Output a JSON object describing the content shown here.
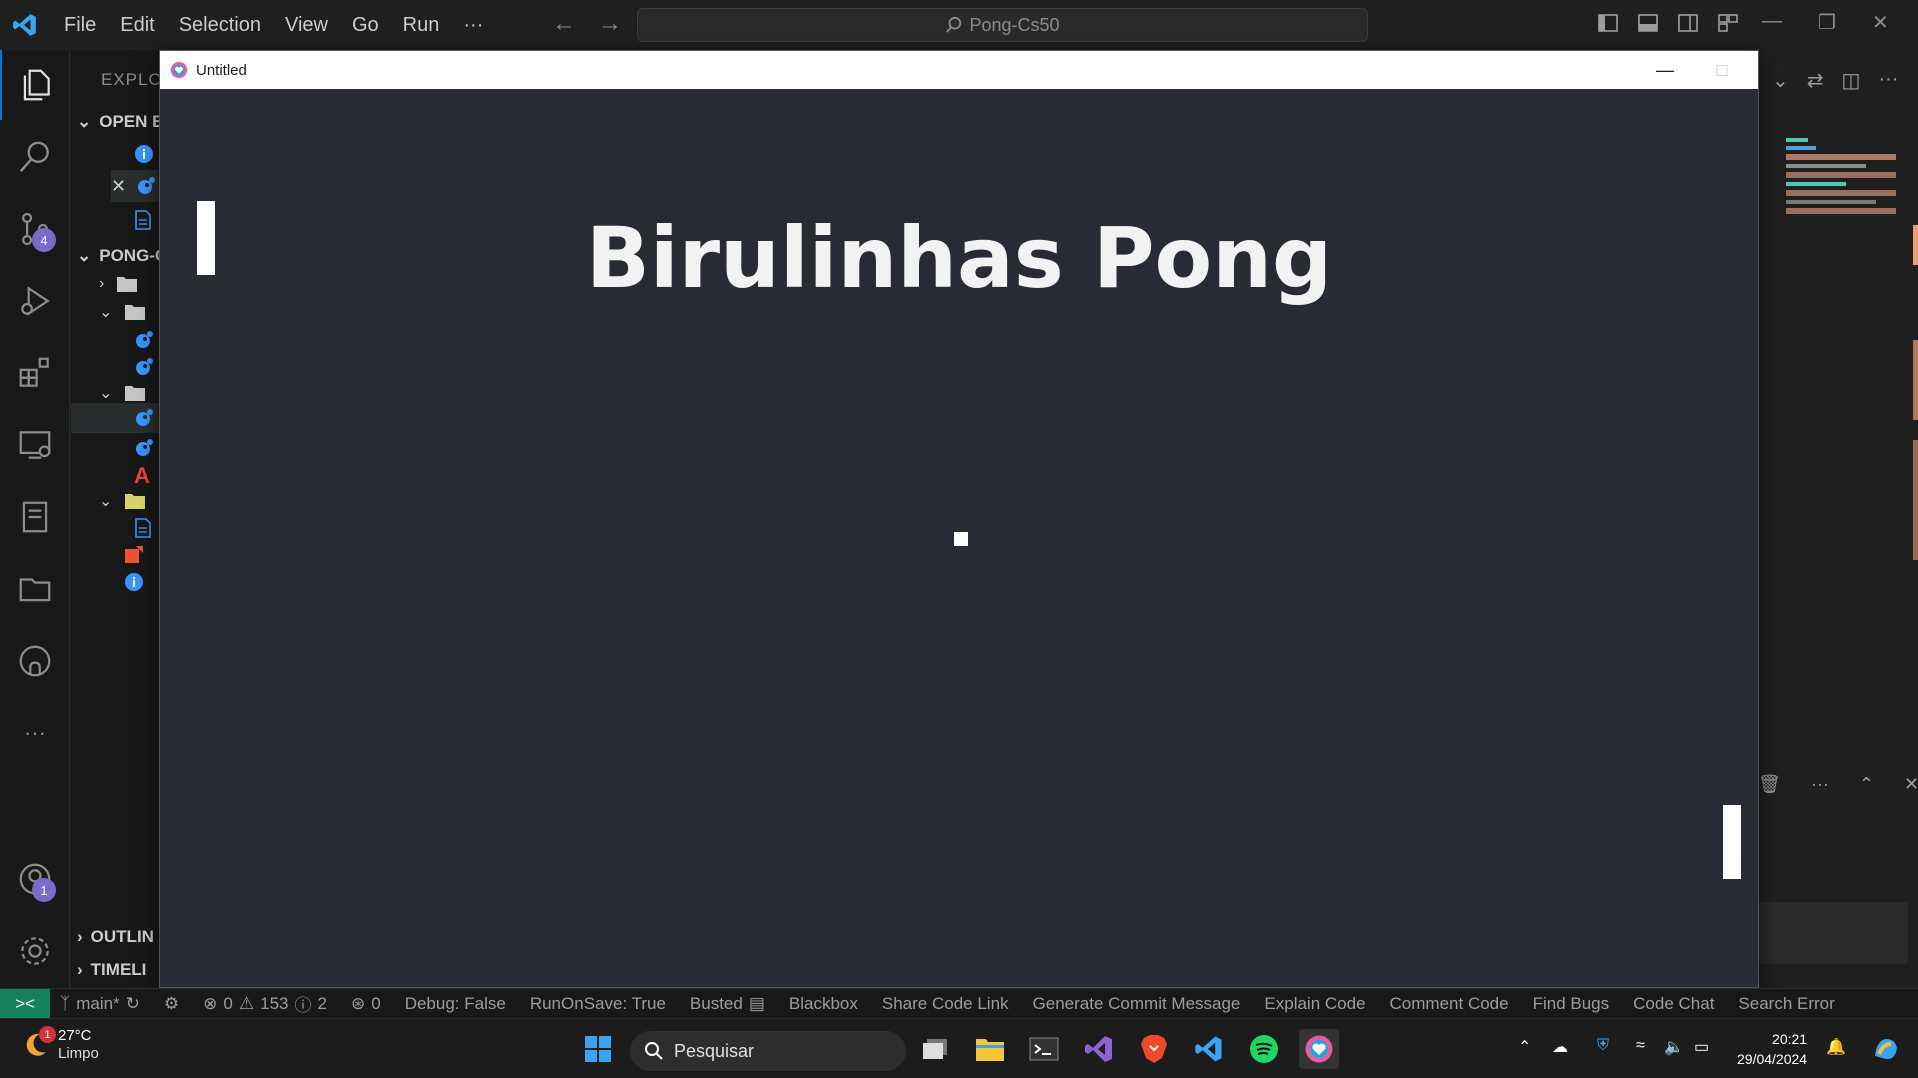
{
  "vscode": {
    "menu": [
      "File",
      "Edit",
      "Selection",
      "View",
      "Go",
      "Run",
      "···"
    ],
    "search_text": "Pong-Cs50",
    "sidebar": {
      "explorer_title": "EXPLOR",
      "open_editors_label": "OPEN E",
      "project_label": "PONG-C",
      "outline_label": "OUTLIN",
      "timeline_label": "TIMELI"
    },
    "activity": {
      "scm_badge": "4",
      "accounts_badge": "1"
    }
  },
  "pong_window": {
    "title": "Untitled",
    "game_title": "Birulinhas Pong"
  },
  "statusbar": {
    "branch": "main*",
    "errors": "0",
    "warnings": "153",
    "infos": "2",
    "ports": "0",
    "items": [
      "Debug: False",
      "RunOnSave: True",
      "Busted",
      "Blackbox",
      "Share Code Link",
      "Generate Commit Message",
      "Explain Code",
      "Comment Code",
      "Find Bugs",
      "Code Chat",
      "Search Error"
    ]
  },
  "taskbar": {
    "weather_temp": "27°C",
    "weather_desc": "Limpo",
    "weather_badge": "1",
    "search_placeholder": "Pesquisar",
    "time": "20:21",
    "date": "29/04/2024"
  },
  "colors": {
    "accent_remote": "#16825d",
    "badge": "#7b6ac9",
    "game_bg": "#282b33"
  }
}
